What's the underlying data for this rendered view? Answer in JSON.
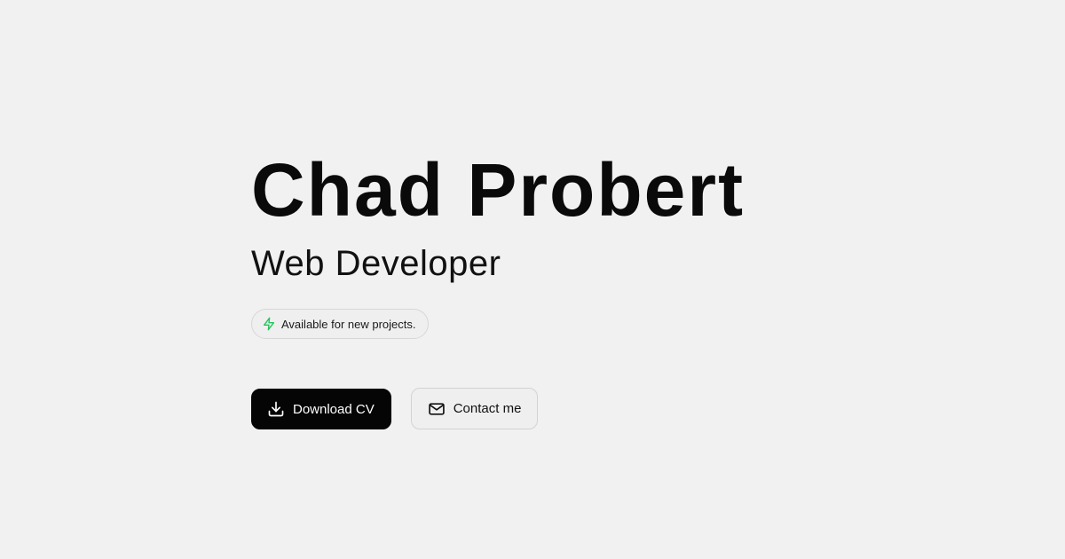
{
  "hero": {
    "name": "Chad Probert",
    "role": "Web Developer"
  },
  "status_badge": {
    "icon": "lightning-icon",
    "icon_color": "#22c55e",
    "text": "Available for new projects."
  },
  "actions": {
    "download_cv": {
      "icon": "download-icon",
      "label": "Download CV"
    },
    "contact": {
      "icon": "mail-icon",
      "label": "Contact me"
    }
  },
  "colors": {
    "background": "#f1f1f1",
    "primary_button": "#050505",
    "accent_green": "#22c55e"
  }
}
